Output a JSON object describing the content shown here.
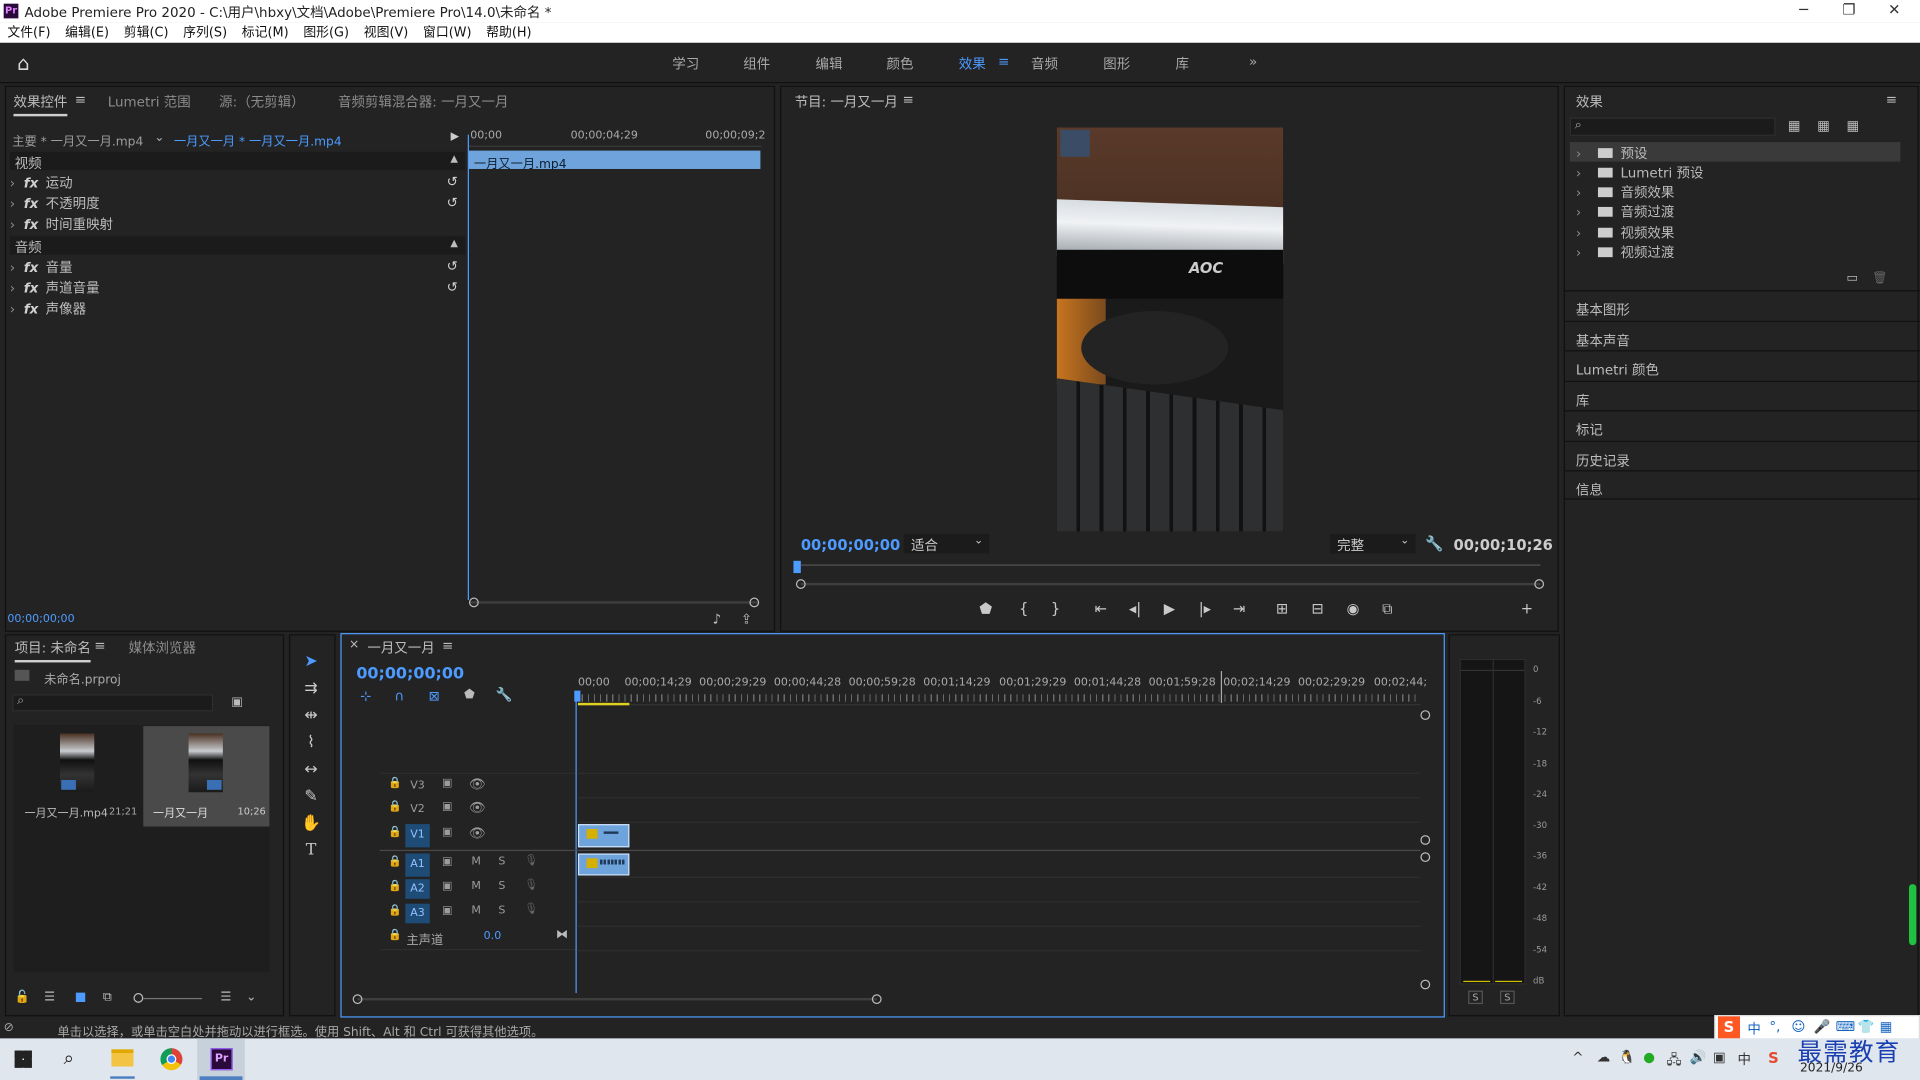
{
  "window": {
    "title": "Adobe Premiere Pro 2020 - C:\\用户\\hbxy\\文档\\Adobe\\Premiere Pro\\14.0\\未命名 *",
    "logo": "Pr"
  },
  "menu": [
    "文件(F)",
    "编辑(E)",
    "剪辑(C)",
    "序列(S)",
    "标记(M)",
    "图形(G)",
    "视图(V)",
    "窗口(W)",
    "帮助(H)"
  ],
  "workspaces": [
    "学习",
    "组件",
    "编辑",
    "颜色",
    "效果",
    "音频",
    "图形",
    "库"
  ],
  "effect_controls": {
    "tabs": [
      "效果控件",
      "Lumetri 范围",
      "源:（无剪辑）",
      "音频剪辑混合器: 一月又一月"
    ],
    "master_label": "主要 * 一月又一月.mp4",
    "sequence_clip": "一月又一月 * 一月又一月.mp4",
    "timecodes": [
      "00;00",
      "00;00;04;29",
      "00;00;09;2"
    ],
    "clip_name": "一月又一月.mp4",
    "video_header": "视频",
    "video_rows": [
      "运动",
      "不透明度",
      "时间重映射"
    ],
    "audio_header": "音频",
    "audio_rows": [
      "音量",
      "声道音量",
      "声像器"
    ],
    "current_time": "00;00;00;00",
    "fx_label": "fx"
  },
  "program": {
    "title": "节目: 一月又一月",
    "timecode": "00;00;00;00",
    "fit": "适合",
    "quality": "完整",
    "duration": "00;00;10;26",
    "video_brand": "AOC"
  },
  "project": {
    "tabs": [
      "项目: 未命名",
      "媒体浏览器"
    ],
    "file": "未命名.prproj",
    "items": [
      {
        "name": "一月又一月.mp4",
        "duration": "21;21"
      },
      {
        "name": "一月又一月",
        "duration": "10;26"
      }
    ]
  },
  "timeline": {
    "title": "一月又一月",
    "timecode": "00;00;00;00",
    "ruler": [
      "00;00",
      "00;00;14;29",
      "00;00;29;29",
      "00;00;44;28",
      "00;00;59;28",
      "00;01;14;29",
      "00;01;29;29",
      "00;01;44;28",
      "00;01;59;28",
      "00;02;14;29",
      "00;02;29;29",
      "00;02;44;"
    ],
    "tracks": {
      "video": [
        "V3",
        "V2",
        "V1"
      ],
      "audio": [
        "A1",
        "A2",
        "A3"
      ],
      "master_label": "主声道",
      "master_value": "0.0",
      "m": "M",
      "s": "S"
    }
  },
  "effects": {
    "title": "效果",
    "folders": [
      "预设",
      "Lumetri 预设",
      "音频效果",
      "音频过渡",
      "视频效果",
      "视频过渡"
    ],
    "sections": [
      "基本图形",
      "基本声音",
      "Lumetri 颜色",
      "库",
      "标记",
      "历史记录",
      "信息"
    ]
  },
  "meters": {
    "labels": [
      "0",
      "-6",
      "-12",
      "-18",
      "-24",
      "-30",
      "-36",
      "-42",
      "-48",
      "-54",
      "dB"
    ],
    "solo": [
      "S",
      "S"
    ]
  },
  "status": "单击以选择，或单击空白处并拖动以进行框选。使用 Shift、Alt 和 Ctrl 可获得其他选项。",
  "taskbar": {
    "date": "2021/9/26",
    "ime": "中"
  },
  "watermark": "最需教育",
  "colors": {
    "accent": "#4d9bff",
    "clip": "#6fa3dc",
    "panel": "#232323"
  }
}
